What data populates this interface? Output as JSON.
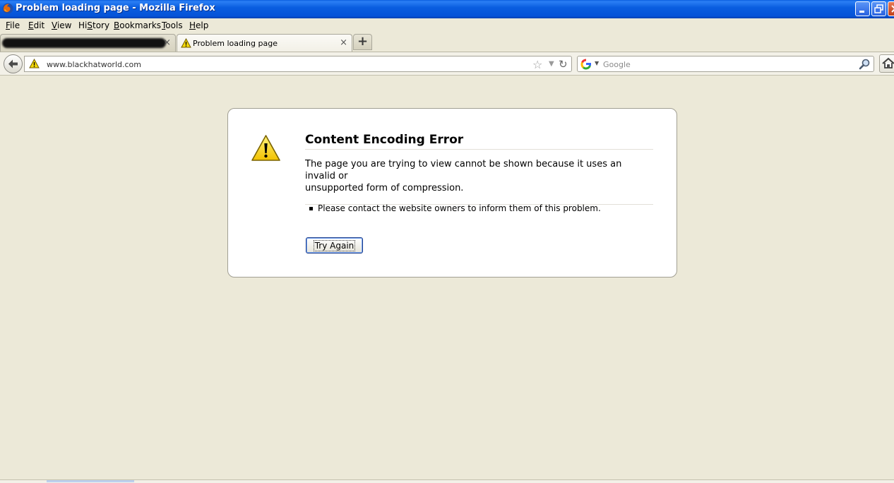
{
  "window": {
    "title": "Problem loading page - Mozilla Firefox"
  },
  "menu": [
    "File",
    "Edit",
    "View",
    "History",
    "Bookmarks",
    "Tools",
    "Help"
  ],
  "menu_access_keys": [
    "F",
    "E",
    "V",
    "S",
    "B",
    "T",
    "H"
  ],
  "tabs": {
    "inactive_close": "×",
    "active_label": "Problem loading page",
    "active_close": "×",
    "new_tab": "+"
  },
  "nav": {
    "url": "www.blackhatworld.com",
    "search_placeholder": "Google"
  },
  "error": {
    "title": "Content Encoding Error",
    "description_line1": "The page you are trying to view cannot be shown because it uses an invalid or",
    "description_line2": "unsupported form of compression.",
    "bullet": "Please contact the website owners to inform them of this problem.",
    "try_again": "Try Again"
  },
  "colors": {
    "titlebar": "#0a5ee0",
    "chrome_bg": "#ece9d8",
    "warning_yellow": "#f5d90a",
    "button_border": "#1c3d8a"
  },
  "icons": {
    "app": "firefox-icon",
    "tab": "warning-icon",
    "back": "back-arrow-icon",
    "identity": "warning-icon",
    "bookmark": "star-icon",
    "reload": "reload-icon",
    "search_engine": "google-icon",
    "search": "magnifier-icon",
    "home": "home-icon"
  }
}
